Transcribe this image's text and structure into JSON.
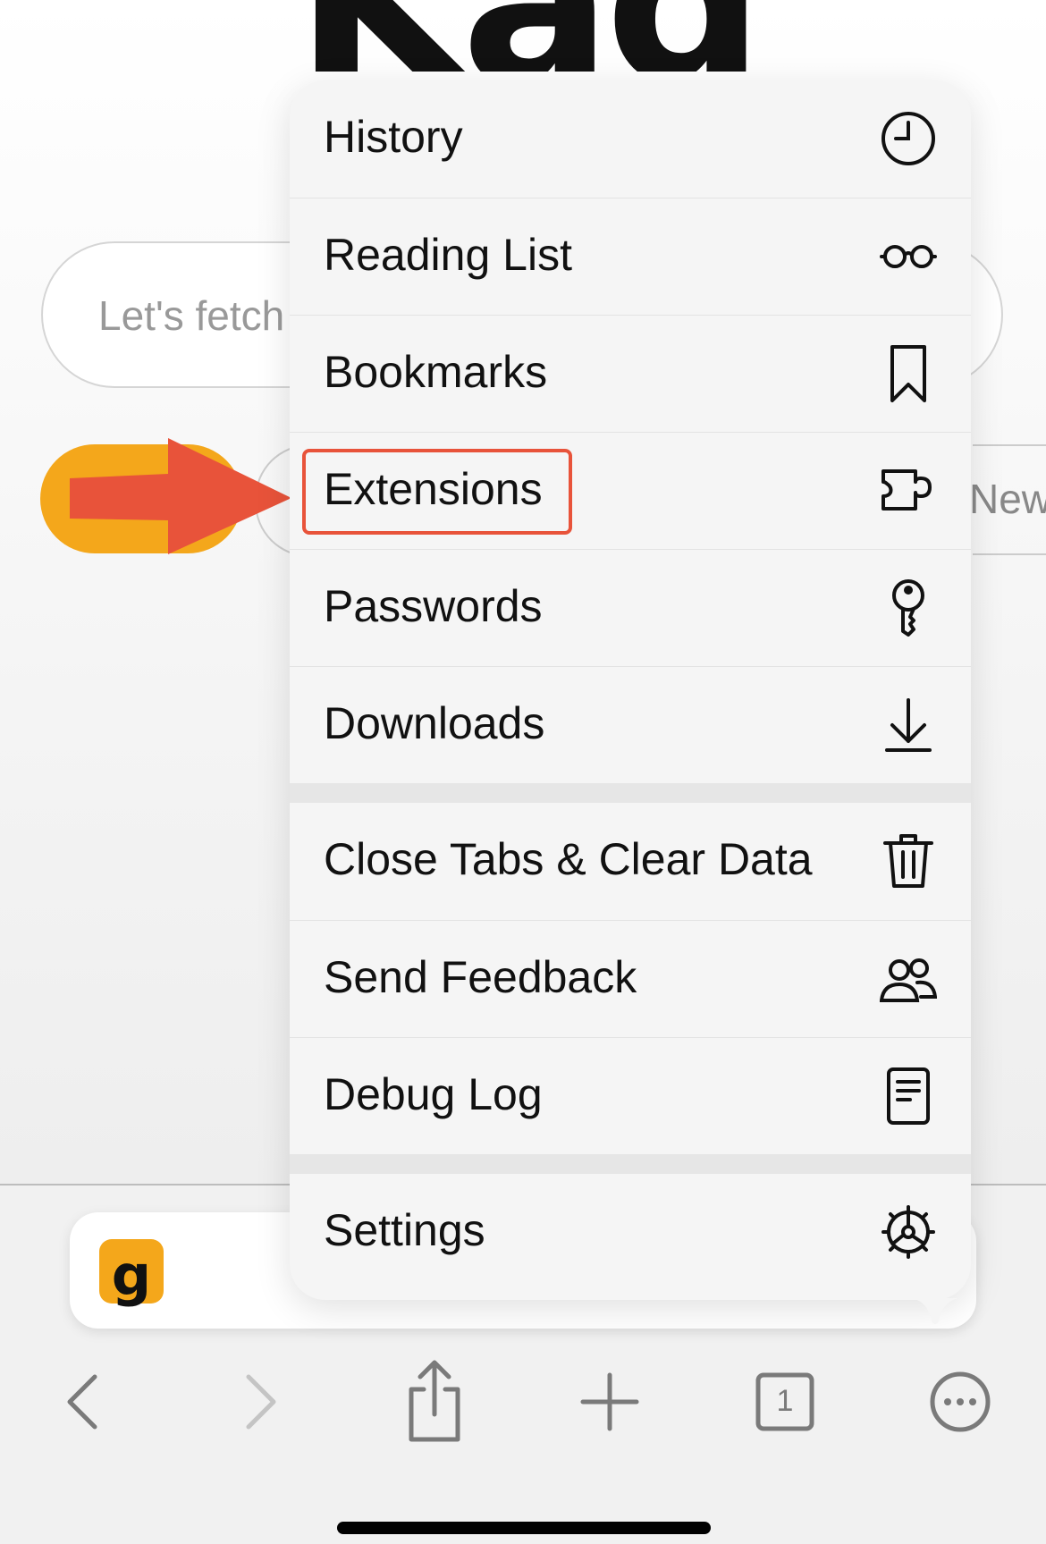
{
  "background": {
    "logo_text": "Kagi",
    "search": {
      "placeholder": "Let's fetch"
    },
    "chip_new_label": "New"
  },
  "menu": {
    "items": [
      {
        "label": "History",
        "icon": "clock-icon"
      },
      {
        "label": "Reading List",
        "icon": "glasses-icon"
      },
      {
        "label": "Bookmarks",
        "icon": "bookmark-icon"
      },
      {
        "label": "Extensions",
        "icon": "puzzle-icon",
        "highlighted": true
      },
      {
        "label": "Passwords",
        "icon": "key-icon"
      },
      {
        "label": "Downloads",
        "icon": "download-icon"
      },
      {
        "label": "Close Tabs & Clear Data",
        "icon": "trash-icon"
      },
      {
        "label": "Send Feedback",
        "icon": "people-icon"
      },
      {
        "label": "Debug Log",
        "icon": "document-icon"
      },
      {
        "label": "Settings",
        "icon": "gear-icon"
      }
    ]
  },
  "address_bar": {
    "favicon_letter": "g"
  },
  "toolbar": {
    "back": "chevron-left-icon",
    "forward": "chevron-right-icon",
    "share": "share-icon",
    "new_tab": "plus-icon",
    "tab_count": "1",
    "more": "more-icon"
  },
  "colors": {
    "accent_yellow": "#f4a71b",
    "annotation_red": "#e8533a",
    "menu_bg": "#f5f5f5"
  }
}
